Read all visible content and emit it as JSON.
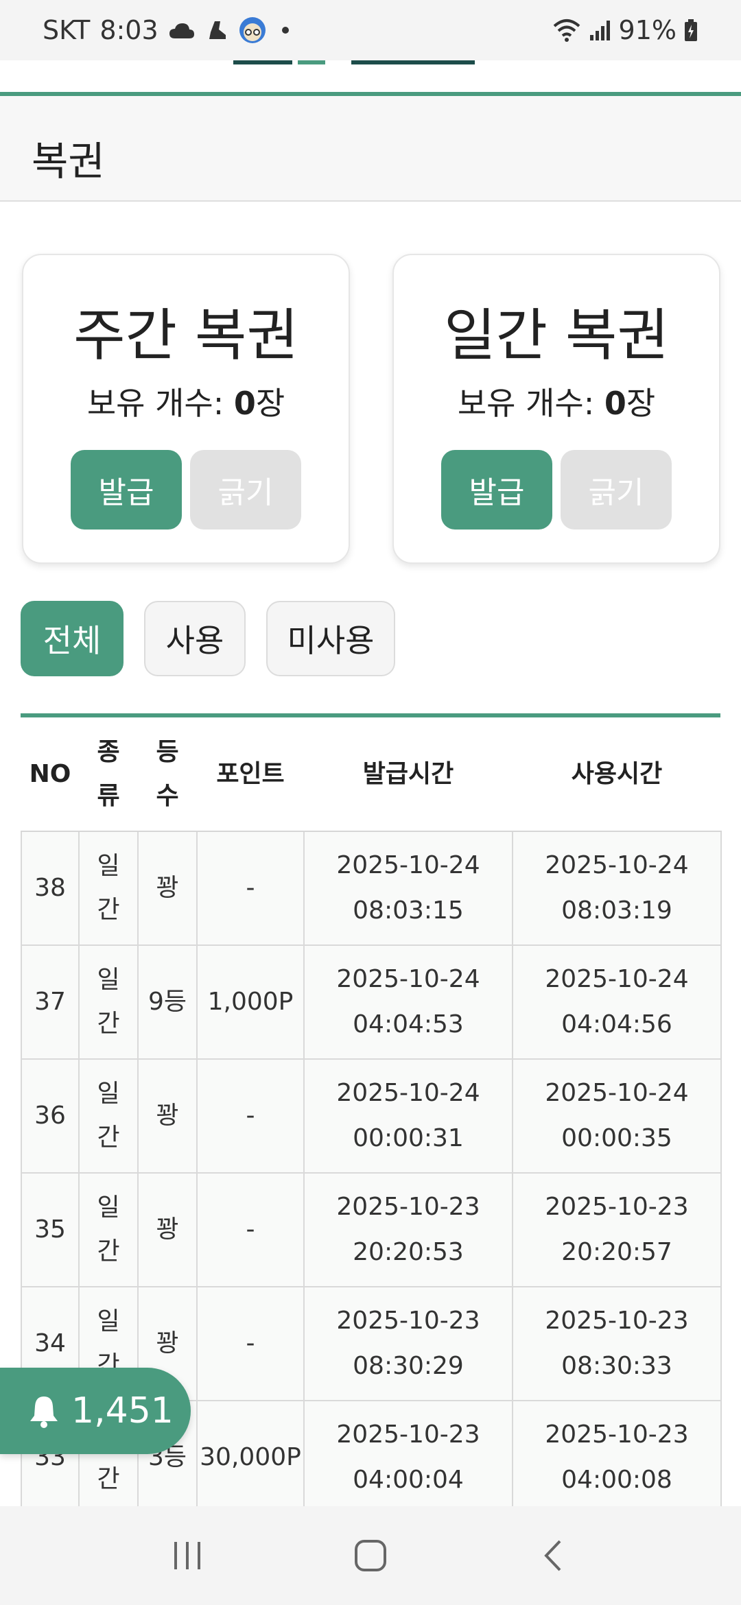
{
  "status_bar": {
    "carrier": "SKT",
    "time": "8:03",
    "battery": "91%",
    "icons": [
      "cloud-icon",
      "shoe-icon",
      "app-avatar-icon",
      "wifi-icon",
      "signal-icon",
      "battery-charging-icon"
    ]
  },
  "header": {
    "title": "복권"
  },
  "cards": [
    {
      "title": "주간 복권",
      "count_label": "보유 개수: ",
      "count_value": "0",
      "count_unit": "장",
      "issue_label": "발급",
      "scratch_label": "긁기"
    },
    {
      "title": "일간 복권",
      "count_label": "보유 개수: ",
      "count_value": "0",
      "count_unit": "장",
      "issue_label": "발급",
      "scratch_label": "긁기"
    }
  ],
  "filters": [
    "전체",
    "사용",
    "미사용"
  ],
  "table": {
    "headers": [
      "NO",
      "종류",
      "등수",
      "포인트",
      "발급시간",
      "사용시간"
    ],
    "rows": [
      [
        "38",
        "일간",
        "꽝",
        "-",
        "2025-10-24 08:03:15",
        "2025-10-24 08:03:19"
      ],
      [
        "37",
        "일간",
        "9등",
        "1,000P",
        "2025-10-24 04:04:53",
        "2025-10-24 04:04:56"
      ],
      [
        "36",
        "일간",
        "꽝",
        "-",
        "2025-10-24 00:00:31",
        "2025-10-24 00:00:35"
      ],
      [
        "35",
        "일간",
        "꽝",
        "-",
        "2025-10-23 20:20:53",
        "2025-10-23 20:20:57"
      ],
      [
        "34",
        "일간",
        "꽝",
        "-",
        "2025-10-23 08:30:29",
        "2025-10-23 08:30:33"
      ],
      [
        "33",
        "일간",
        "3등",
        "30,000P",
        "2025-10-23 04:00:04",
        "2025-10-23 04:00:08"
      ]
    ]
  },
  "notification": {
    "count": "1,451",
    "icon": "bell-icon"
  },
  "colors": {
    "accent": "#4a9b7f",
    "disabled": "#e1e1e1"
  }
}
